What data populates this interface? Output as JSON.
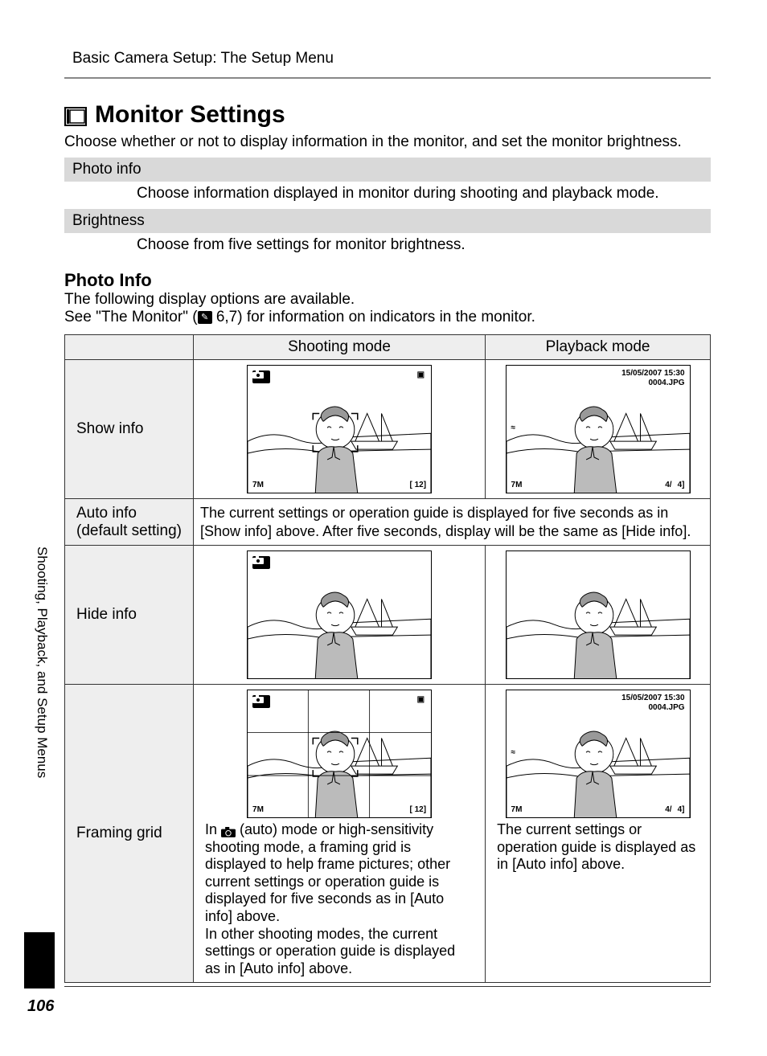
{
  "header": {
    "title": "Basic Camera Setup: The Setup Menu"
  },
  "section": {
    "title": "Monitor Settings",
    "intro": "Choose whether or not to display information in the monitor, and set the monitor brightness."
  },
  "summary_rows": [
    {
      "label": "Photo info",
      "desc": "Choose information displayed in monitor during shooting and playback mode."
    },
    {
      "label": "Brightness",
      "desc": "Choose from five settings for monitor brightness."
    }
  ],
  "photo_info": {
    "heading": "Photo Info",
    "line1": "The following display options are available.",
    "line2a": "See \"The Monitor\" (",
    "line2b": " 6,7) for information on indicators in the monitor."
  },
  "table": {
    "headers": {
      "col0": "",
      "col1": "Shooting mode",
      "col2": "Playback mode"
    },
    "rows": {
      "show": {
        "label": "Show info"
      },
      "auto": {
        "label": "Auto info (default setting)",
        "desc": "The current settings or operation guide is displayed for five seconds as in [Show info] above. After five seconds, display will be the same as [Hide info]."
      },
      "hide": {
        "label": "Hide info"
      },
      "grid": {
        "label": "Framing grid",
        "shoot_desc_a": "In ",
        "shoot_desc_b": " (auto) mode or high-sensitivity shooting mode, a framing grid is displayed to help frame pictures; other current settings or operation guide is displayed for five seconds as in [Auto info] above.",
        "shoot_desc_c": "In other shooting modes, the current settings or operation guide is displayed as in [Auto info] above.",
        "play_desc": "The current settings or operation guide is displayed as in [Auto info] above."
      }
    }
  },
  "osd": {
    "date": "15/05/2007 15:30",
    "filename": "0004.JPG",
    "size_mark": "7M",
    "counter_shoot": "[   12]",
    "counter_play_a": "4/",
    "counter_play_b": "4]"
  },
  "sidebar": {
    "text": "Shooting, Playback, and Setup Menus"
  },
  "page_number": "106"
}
